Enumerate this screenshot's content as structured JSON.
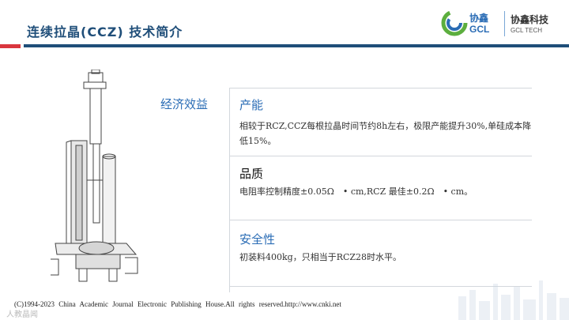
{
  "header": {
    "title": "连续拉晶(CCZ) 技术简介",
    "logo": {
      "brand_cn": "协鑫",
      "brand_en": "GCL",
      "company_cn": "协鑫科技",
      "company_en": "GCL TECH",
      "colors": {
        "blue": "#2a6cb5",
        "green": "#5cae3e"
      }
    }
  },
  "section": {
    "label": "经济效益",
    "items": [
      {
        "title": "产能",
        "title_color": "#2a6cb5",
        "text": "相较于RCZ,CCZ每根拉晶时间节约8h左右，极限产能提升30%,单硅成本降低15%。"
      },
      {
        "title": "品质",
        "title_color": "#111111",
        "text": "电阻率控制精度±0.05Ω　• cm,RCZ 最佳±0.2Ω　• cm。"
      },
      {
        "title": "安全性",
        "title_color": "#2a6cb5",
        "text": "初装料400kg，只相当于RCZ28时水平。"
      }
    ]
  },
  "footer": {
    "copyright": "(C)1994-2023 China Academic Journal Electronic Publishing House.All rights reserved.http://www.cnki.net",
    "watermark": "人教晶闻"
  },
  "colors": {
    "accent_red": "#d9363e",
    "accent_blue": "#1f4e79"
  }
}
